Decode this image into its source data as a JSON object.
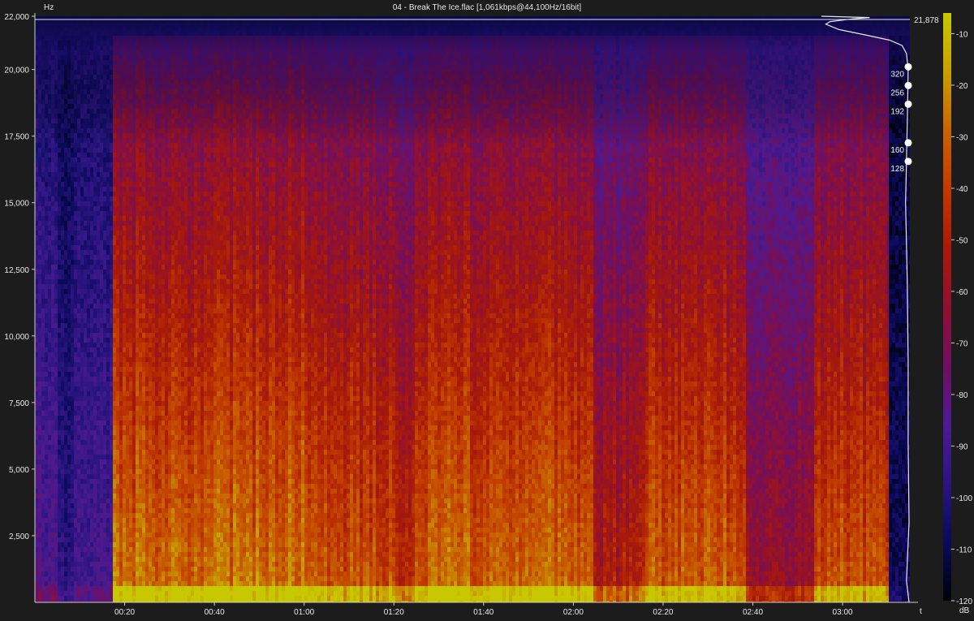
{
  "window": {
    "title": "04 - Break The Ice.flac [1,061kbps@44,100Hz/16bit]"
  },
  "theme": {
    "background": "#1c1c1c",
    "axis_color": "#cfcfcf",
    "text_color": "#e8e8e8",
    "marker_color": "#ffffff"
  },
  "chart_data": {
    "type": "heatmap",
    "title": "04 - Break The Ice.flac [1,061kbps@44,100Hz/16bit]",
    "xlabel": "t",
    "ylabel": "Hz",
    "colorbar_label": "dB",
    "xlim_seconds": [
      0,
      195
    ],
    "ylim_hz": [
      0,
      22000
    ],
    "x_ticks": [
      {
        "seconds": 20,
        "label": "00:20"
      },
      {
        "seconds": 40,
        "label": "00:40"
      },
      {
        "seconds": 60,
        "label": "01:00"
      },
      {
        "seconds": 80,
        "label": "01:20"
      },
      {
        "seconds": 100,
        "label": "01:40"
      },
      {
        "seconds": 120,
        "label": "02:00"
      },
      {
        "seconds": 140,
        "label": "02:20"
      },
      {
        "seconds": 160,
        "label": "02:40"
      },
      {
        "seconds": 180,
        "label": "03:00"
      }
    ],
    "y_ticks": [
      {
        "hz": 22000,
        "label": "22,000"
      },
      {
        "hz": 20000,
        "label": "20,000"
      },
      {
        "hz": 17500,
        "label": "17,500"
      },
      {
        "hz": 15000,
        "label": "15,000"
      },
      {
        "hz": 12500,
        "label": "12,500"
      },
      {
        "hz": 10000,
        "label": "10,000"
      },
      {
        "hz": 7500,
        "label": "7,500"
      },
      {
        "hz": 5000,
        "label": "5,000"
      },
      {
        "hz": 2500,
        "label": "2,500"
      }
    ],
    "colorbar": {
      "range_db": [
        -120,
        -6
      ],
      "ticks": [
        {
          "db": -10,
          "label": "-10"
        },
        {
          "db": -20,
          "label": "-20"
        },
        {
          "db": -30,
          "label": "-30"
        },
        {
          "db": -40,
          "label": "-40"
        },
        {
          "db": -50,
          "label": "-50"
        },
        {
          "db": -60,
          "label": "-60"
        },
        {
          "db": -70,
          "label": "-70"
        },
        {
          "db": -80,
          "label": "-80"
        },
        {
          "db": -90,
          "label": "-90"
        },
        {
          "db": -100,
          "label": "-100"
        },
        {
          "db": -110,
          "label": "-110"
        },
        {
          "db": -120,
          "label": "-120"
        }
      ],
      "gradient": [
        "#000008",
        "#0a0a5a",
        "#2a1580",
        "#4d1a90",
        "#6e1060",
        "#901030",
        "#a81a08",
        "#c03a00",
        "#c86400",
        "#c8a000",
        "#c8c800"
      ]
    },
    "cutoff": {
      "hz": 21878,
      "label": "21,878"
    },
    "bitrate_markers": [
      {
        "kbps": 320,
        "hz": 20100,
        "label": "320"
      },
      {
        "kbps": 256,
        "hz": 19400,
        "label": "256"
      },
      {
        "kbps": 192,
        "hz": 18700,
        "label": "192"
      },
      {
        "kbps": 160,
        "hz": 17250,
        "label": "160"
      },
      {
        "kbps": 128,
        "hz": 16550,
        "label": "128"
      }
    ],
    "spectrum_profile": [
      {
        "hz": 22000,
        "x": 0.0
      },
      {
        "hz": 21950,
        "x": 0.55
      },
      {
        "hz": 21900,
        "x": 0.35
      },
      {
        "hz": 21800,
        "x": 0.1
      },
      {
        "hz": 21700,
        "x": 0.05
      },
      {
        "hz": 21500,
        "x": 0.2
      },
      {
        "hz": 21300,
        "x": 0.5
      },
      {
        "hz": 21100,
        "x": 0.78
      },
      {
        "hz": 20900,
        "x": 0.92
      },
      {
        "hz": 20600,
        "x": 0.97
      },
      {
        "hz": 20000,
        "x": 0.99
      },
      {
        "hz": 18000,
        "x": 0.98
      },
      {
        "hz": 15000,
        "x": 0.96
      },
      {
        "hz": 12000,
        "x": 0.98
      },
      {
        "hz": 9000,
        "x": 0.99
      },
      {
        "hz": 6000,
        "x": 0.99
      },
      {
        "hz": 3000,
        "x": 1.0
      },
      {
        "hz": 800,
        "x": 0.97
      },
      {
        "hz": 0,
        "x": 1.0
      }
    ],
    "music_segments": [
      {
        "start": 0,
        "end": 4.5,
        "level": 0.35
      },
      {
        "start": 4.5,
        "end": 8.5,
        "level": 0.22
      },
      {
        "start": 8.5,
        "end": 17,
        "level": 0.3
      },
      {
        "start": 17,
        "end": 62,
        "level": 0.92
      },
      {
        "start": 62,
        "end": 80,
        "level": 0.84
      },
      {
        "start": 80,
        "end": 84,
        "level": 0.72
      },
      {
        "start": 84,
        "end": 124,
        "level": 0.9
      },
      {
        "start": 124,
        "end": 136,
        "level": 0.68
      },
      {
        "start": 136,
        "end": 158,
        "level": 0.86
      },
      {
        "start": 158,
        "end": 173,
        "level": 0.58
      },
      {
        "start": 173,
        "end": 190,
        "level": 0.84
      },
      {
        "start": 190,
        "end": 195,
        "level": 0.12
      }
    ]
  }
}
